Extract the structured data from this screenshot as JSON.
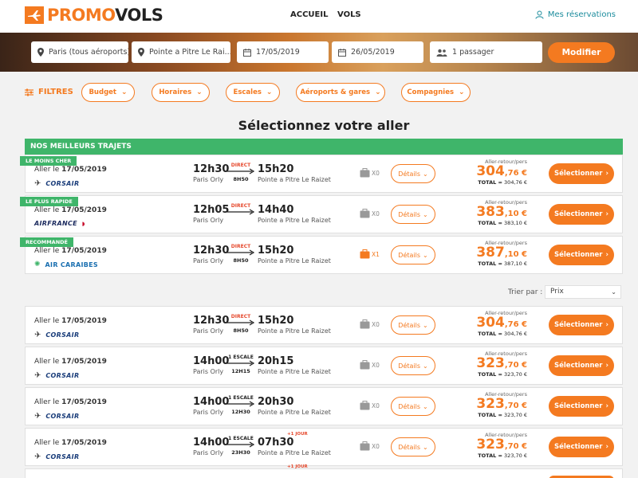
{
  "brand": {
    "promo": "PROMO",
    "vols": "VOLS",
    "accent": "#f47a20",
    "green": "#3fb56a"
  },
  "nav": {
    "accueil": "ACCUEIL",
    "vols": "VOLS",
    "reservations": "Mes réservations"
  },
  "search": {
    "from": "Paris (tous aéroports)",
    "to": "Pointe a Pitre Le Rai...",
    "date_out": "17/05/2019",
    "date_back": "26/05/2019",
    "passengers": "1 passager",
    "button": "Modifier"
  },
  "filters": {
    "label": "FILTRES",
    "chips": [
      "Budget",
      "Horaires",
      "Escales",
      "Aéroports & gares",
      "Compagnies"
    ]
  },
  "page_title": "Sélectionnez votre aller",
  "best_header": "NOS MEILLEURS TRAJETS",
  "sort": {
    "label": "Trier par :",
    "value": "Prix"
  },
  "common": {
    "date_prefix": "Aller le",
    "details": "Détails",
    "select": "Sélectionner",
    "price_label": "Aller-retour/pers",
    "total_label": "TOTAL ="
  },
  "best": [
    {
      "ribbon": "LE MOINS CHER",
      "date": "17/05/2019",
      "airline": "CORSAIR",
      "dep_time": "12h30",
      "dep_airport": "Paris Orly",
      "stop": "DIRECT",
      "duration": "8H50",
      "arr_time": "15h20",
      "arr_airport": "Pointe a Pitre Le Raizet",
      "bags": "X0",
      "price_int": "304",
      "price_dec": ",76",
      "currency": "€",
      "total": "304,76 €"
    },
    {
      "ribbon": "LE PLUS RAPIDE",
      "date": "17/05/2019",
      "airline": "AIRFRANCE",
      "dep_time": "12h05",
      "dep_airport": "Paris Orly",
      "stop": "DIRECT",
      "duration": "",
      "arr_time": "14h40",
      "arr_airport": "Pointe a Pitre Le Raizet",
      "bags": "X0",
      "price_int": "383",
      "price_dec": ",10",
      "currency": "€",
      "total": "383,10 €"
    },
    {
      "ribbon": "RECOMMANDÉ",
      "date": "17/05/2019",
      "airline": "AIR CARAIBES",
      "dep_time": "12h30",
      "dep_airport": "Paris Orly",
      "stop": "DIRECT",
      "duration": "8H50",
      "arr_time": "15h20",
      "arr_airport": "Pointe a Pitre Le Raizet",
      "bags": "X1",
      "price_int": "387",
      "price_dec": ",10",
      "currency": "€",
      "total": "387,10 €"
    }
  ],
  "results": [
    {
      "date": "17/05/2019",
      "airline": "CORSAIR",
      "dep_time": "12h30",
      "dep_airport": "Paris Orly",
      "stop": "DIRECT",
      "duration": "8H50",
      "arr_time": "15h20",
      "arr_airport": "Pointe a Pitre Le Raizet",
      "bags": "X0",
      "price_int": "304",
      "price_dec": ",76",
      "currency": "€",
      "total": "304,76 €"
    },
    {
      "date": "17/05/2019",
      "airline": "CORSAIR",
      "dep_time": "14h00",
      "dep_airport": "Paris Orly",
      "stop": "1 ESCALE",
      "duration": "12H15",
      "arr_time": "20h15",
      "arr_airport": "Pointe a Pitre Le Raizet",
      "bags": "X0",
      "price_int": "323",
      "price_dec": ",70",
      "currency": "€",
      "total": "323,70 €"
    },
    {
      "date": "17/05/2019",
      "airline": "CORSAIR",
      "dep_time": "14h00",
      "dep_airport": "Paris Orly",
      "stop": "1 ESCALE",
      "duration": "12H30",
      "arr_time": "20h30",
      "arr_airport": "Pointe a Pitre Le Raizet",
      "bags": "X0",
      "price_int": "323",
      "price_dec": ",70",
      "currency": "€",
      "total": "323,70 €"
    },
    {
      "date": "17/05/2019",
      "airline": "CORSAIR",
      "dep_time": "14h00",
      "dep_airport": "Paris Orly",
      "stop": "1 ESCALE",
      "duration": "23H30",
      "arr_time": "07h30",
      "plus_day": "+1 JOUR",
      "arr_airport": "Pointe a Pitre Le Raizet",
      "bags": "X0",
      "price_int": "323",
      "price_dec": ",70",
      "currency": "€",
      "total": "323,70 €"
    }
  ],
  "next_card_plus_day": "+1 JOUR"
}
